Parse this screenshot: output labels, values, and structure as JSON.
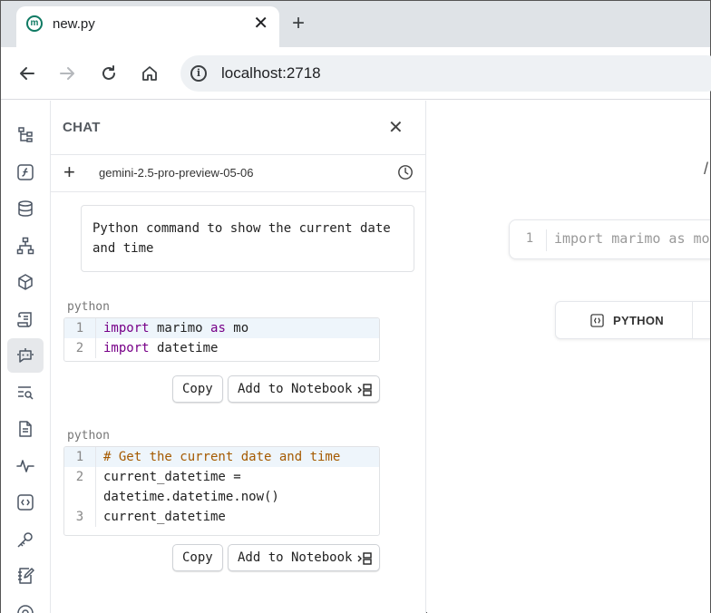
{
  "browser": {
    "tab_title": "new.py",
    "favicon_letter": "m",
    "new_tab": "+",
    "url": "localhost:2718"
  },
  "chat": {
    "title": "CHAT",
    "close": "✕",
    "new_chat": "+",
    "model": "gemini-2.5-pro-preview-05-06",
    "prompt": "Python command to show the current date and time",
    "responses": [
      {
        "language": "python",
        "lines": [
          {
            "num": "1",
            "kw": "import",
            "rest": " marimo ",
            "kw2": "as",
            "rest2": " mo"
          },
          {
            "num": "2",
            "kw": "import",
            "rest": " datetime"
          }
        ],
        "copy_label": "Copy",
        "add_label": "Add to Notebook"
      },
      {
        "language": "python",
        "lines": [
          {
            "num": "1",
            "comment": "# Get the current date and time"
          },
          {
            "num": "2",
            "text": "current_datetime ="
          },
          {
            "num": "",
            "text": "datetime.datetime.now()"
          },
          {
            "num": "3",
            "text": "current_datetime"
          }
        ],
        "copy_label": "Copy",
        "add_label": "Add to Notebook"
      }
    ]
  },
  "notebook": {
    "slash": "/",
    "cell_number": "1",
    "cell_code": "import marimo as mo",
    "python_button": "PYTHON"
  },
  "icons": {
    "rail": [
      "file-tree-icon",
      "function-icon",
      "database-icon",
      "dependency-graph-icon",
      "package-icon",
      "scroll-icon",
      "chat-bot-icon",
      "search-list-icon",
      "document-icon",
      "activity-icon",
      "code-braces-icon",
      "key-icon",
      "notebook-edit-icon",
      "help-icon"
    ]
  },
  "colors": {
    "accent": "#0f7a63",
    "keyword": "#770088",
    "comment": "#a55a00"
  }
}
